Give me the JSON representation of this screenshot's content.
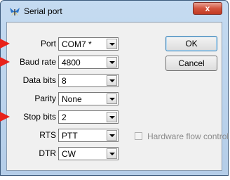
{
  "window": {
    "title": "Serial port",
    "close_label": "x"
  },
  "fields": [
    {
      "label": "Port",
      "value": "COM7 *"
    },
    {
      "label": "Baud rate",
      "value": "4800"
    },
    {
      "label": "Data bits",
      "value": "8"
    },
    {
      "label": "Parity",
      "value": "None"
    },
    {
      "label": "Stop bits",
      "value": "2"
    },
    {
      "label": "RTS",
      "value": "PTT"
    },
    {
      "label": "DTR",
      "value": "CW"
    }
  ],
  "buttons": {
    "ok": "OK",
    "cancel": "Cancel"
  },
  "hardware_flow": {
    "label": "Hardware flow control",
    "checked": false,
    "enabled": false
  },
  "highlight_markers": {
    "color": "#e8221a",
    "rows": [
      "Port",
      "Baud rate",
      "Stop bits"
    ]
  }
}
